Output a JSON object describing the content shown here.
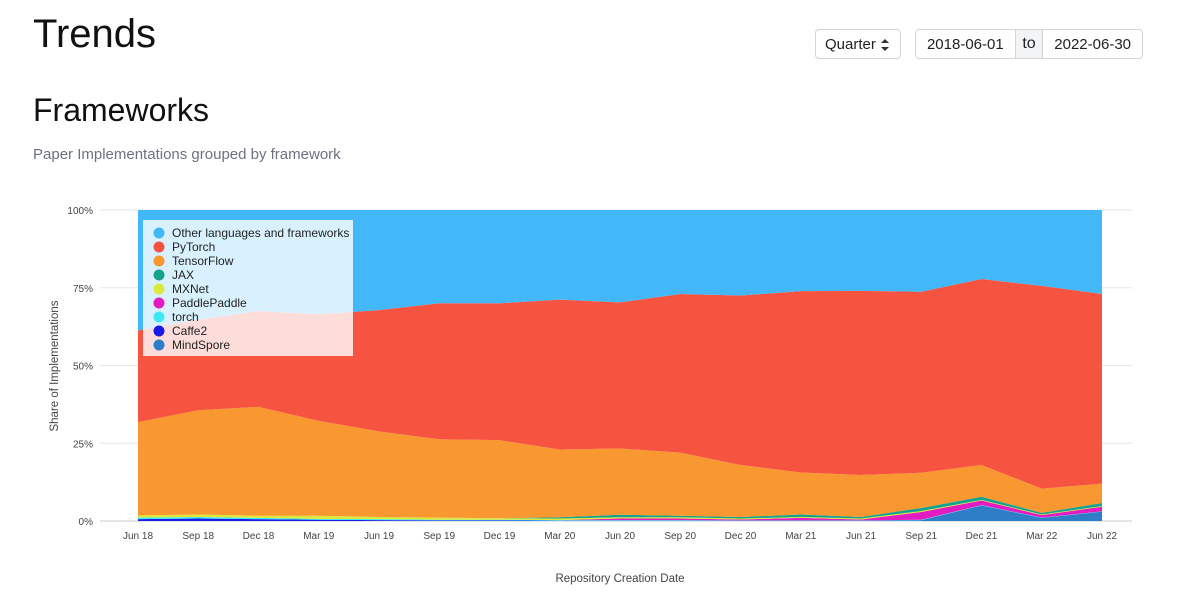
{
  "header": {
    "title": "Trends"
  },
  "controls": {
    "period_select": {
      "value": "Quarter"
    },
    "date_range": {
      "start": "2018-06-01",
      "separator": "to",
      "end": "2022-06-30"
    }
  },
  "section": {
    "title": "Frameworks",
    "subtitle": "Paper Implementations grouped by framework"
  },
  "chart_data": {
    "type": "area",
    "stacking": "percent",
    "xlabel": "Repository Creation Date",
    "ylabel": "Share of Implementations",
    "ylim": [
      0,
      100
    ],
    "y_ticks": [
      "0%",
      "25%",
      "50%",
      "75%",
      "100%"
    ],
    "categories": [
      "Jun 18",
      "Sep 18",
      "Dec 18",
      "Mar 19",
      "Jun 19",
      "Sep 19",
      "Dec 19",
      "Mar 20",
      "Jun 20",
      "Sep 20",
      "Dec 20",
      "Mar 21",
      "Jun 21",
      "Sep 21",
      "Dec 21",
      "Mar 22",
      "Jun 22"
    ],
    "grid": true,
    "legend_position": "top-left",
    "series": [
      {
        "name": "MindSpore",
        "color": "#2e7dc7",
        "values": [
          0,
          0,
          0,
          0,
          0,
          0,
          0,
          0,
          0,
          0,
          0,
          0,
          0,
          0.3,
          5.0,
          1.0,
          3.0
        ]
      },
      {
        "name": "Caffe2",
        "color": "#1a1ae6",
        "values": [
          0.6,
          0.8,
          0.6,
          0.4,
          0.3,
          0.2,
          0.2,
          0.1,
          0.1,
          0.1,
          0.1,
          0.1,
          0.1,
          0,
          0,
          0,
          0
        ]
      },
      {
        "name": "torch",
        "color": "#3ee8f5",
        "values": [
          0.5,
          0.5,
          0.4,
          0.3,
          0.3,
          0.2,
          0.2,
          0.2,
          0.2,
          0.2,
          0.1,
          0.1,
          0.1,
          0.1,
          0.1,
          0.1,
          0.1
        ]
      },
      {
        "name": "PaddlePaddle",
        "color": "#e31bc0",
        "values": [
          0,
          0,
          0,
          0,
          0,
          0,
          0,
          0,
          0.5,
          0.5,
          0.3,
          0.8,
          0.3,
          2.5,
          1.5,
          0.8,
          1.5
        ]
      },
      {
        "name": "MXNet",
        "color": "#dce83a",
        "values": [
          0.7,
          0.8,
          0.7,
          1.0,
          0.7,
          0.7,
          0.5,
          0.5,
          0.4,
          0.4,
          0.3,
          0.3,
          0.3,
          0.3,
          0.2,
          0.2,
          0.2
        ]
      },
      {
        "name": "JAX",
        "color": "#17a28e",
        "values": [
          0,
          0,
          0,
          0,
          0,
          0,
          0,
          0.4,
          0.8,
          0.5,
          0.5,
          0.8,
          0.5,
          1.0,
          1.0,
          0.5,
          1.0
        ]
      },
      {
        "name": "TensorFlow",
        "color": "#f99830",
        "values": [
          30.0,
          33.5,
          35.0,
          30.5,
          27.5,
          25.2,
          25.1,
          21.8,
          21.3,
          20.3,
          16.7,
          13.5,
          13.5,
          11.3,
          10.2,
          7.8,
          6.2
        ]
      },
      {
        "name": "PyTorch",
        "color": "#f65440",
        "values": [
          29.5,
          29.1,
          30.8,
          34.3,
          39.0,
          43.7,
          44.0,
          48.2,
          47.0,
          51.0,
          54.5,
          58.3,
          59.2,
          58.2,
          59.8,
          65.2,
          61.0
        ]
      },
      {
        "name": "Other languages and frameworks",
        "color": "#42b8f8",
        "values": [
          38.7,
          35.3,
          32.5,
          33.5,
          32.2,
          30.0,
          30.0,
          28.8,
          29.7,
          27.0,
          27.5,
          26.1,
          26.0,
          26.3,
          22.2,
          24.4,
          27.0
        ]
      }
    ]
  }
}
